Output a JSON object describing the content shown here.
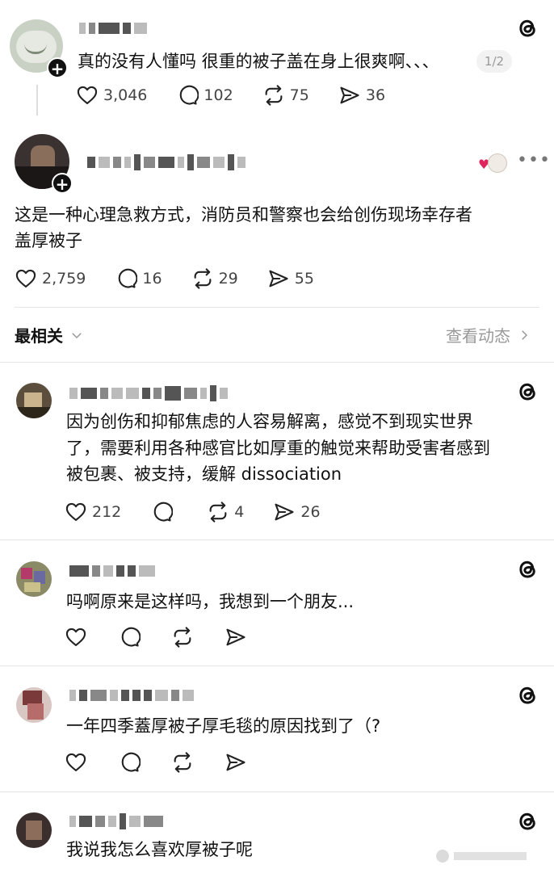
{
  "post1": {
    "text": "真的没有人懂吗 很重的被子盖在身上很爽啊、、、",
    "page_indicator": "1/2",
    "likes": "3,046",
    "comments": "102",
    "reposts": "75",
    "shares": "36"
  },
  "post2": {
    "text_line1": "这是一种心理急救方式，消防员和警察也会给创伤现场幸存者",
    "text_line2": "盖厚被子",
    "likes": "2,759",
    "comments": "16",
    "reposts": "29",
    "shares": "55"
  },
  "sort_bar": {
    "sort_label": "最相关",
    "activity_label": "查看动态"
  },
  "replies": [
    {
      "line1": "因为创伤和抑郁焦虑的人容易解离，感觉不到现实世界",
      "line2": "了，需要利用各种感官比如厚重的触觉来帮助受害者感到",
      "line3": "被包裹、被支持，缓解 dissociation",
      "likes": "212",
      "comments": "",
      "reposts": "4",
      "shares": "26"
    },
    {
      "line1": "吗啊原来是这样吗，我想到一个朋友..."
    },
    {
      "line1": "一年四季蓋厚被子厚毛毯的原因找到了（?"
    },
    {
      "line1": "我说我怎么喜欢厚被子呢"
    }
  ],
  "icons": {
    "like": "heart-icon",
    "comment": "comment-bubble-icon",
    "repost": "repost-icon",
    "share": "send-icon",
    "logo": "threads-logo-icon"
  }
}
